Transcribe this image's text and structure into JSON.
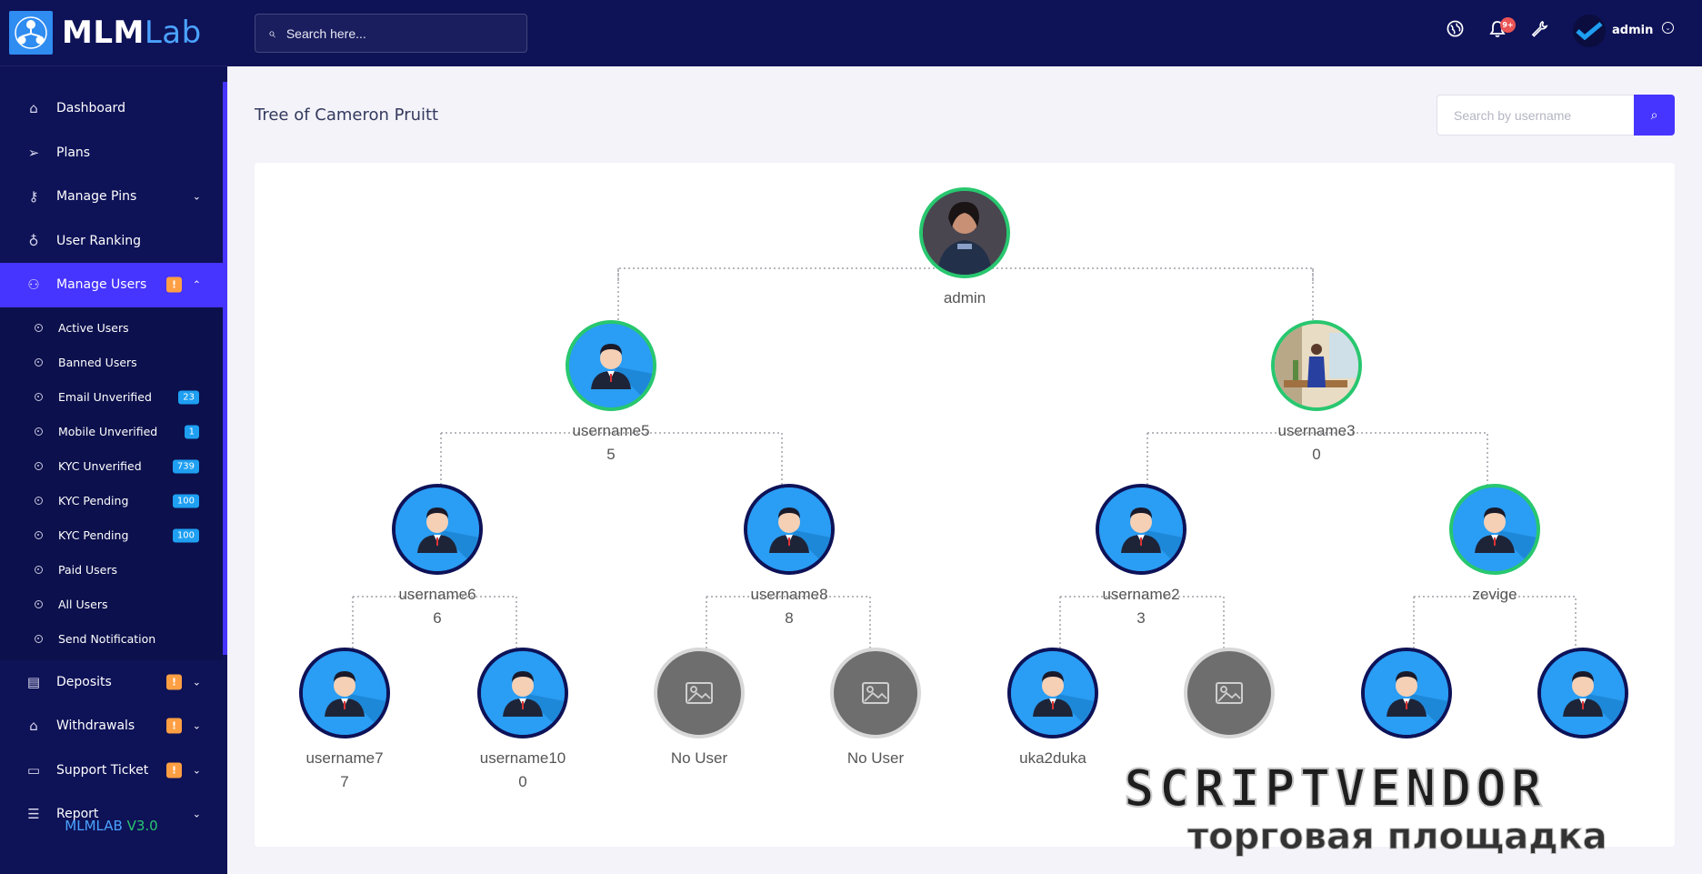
{
  "brand": {
    "logo_bold": "MLM",
    "logo_light": "Lab"
  },
  "sidebar": {
    "items": [
      {
        "label": "Dashboard",
        "icon": "home-icon"
      },
      {
        "label": "Plans",
        "icon": "send-icon"
      },
      {
        "label": "Manage Pins",
        "icon": "key-icon",
        "chevron": "down"
      },
      {
        "label": "User Ranking",
        "icon": "medal-icon"
      },
      {
        "label": "Manage Users",
        "icon": "users-icon",
        "badge": "!",
        "chevron": "up",
        "active": true
      }
    ],
    "subitems": [
      {
        "label": "Active Users"
      },
      {
        "label": "Banned Users"
      },
      {
        "label": "Email Unverified",
        "count": "23"
      },
      {
        "label": "Mobile Unverified",
        "count": "1"
      },
      {
        "label": "KYC Unverified",
        "count": "739"
      },
      {
        "label": "KYC Pending",
        "count": "100"
      },
      {
        "label": "KYC Pending",
        "count": "100"
      },
      {
        "label": "Paid Users"
      },
      {
        "label": "All Users"
      },
      {
        "label": "Send Notification"
      }
    ],
    "items_after": [
      {
        "label": "Deposits",
        "icon": "deposit-icon",
        "badge": "!"
      },
      {
        "label": "Withdrawals",
        "icon": "bank-icon",
        "badge": "!"
      },
      {
        "label": "Support Ticket",
        "icon": "ticket-icon",
        "badge": "!"
      },
      {
        "label": "Report",
        "icon": "list-icon"
      }
    ],
    "version_name": "MLMLAB",
    "version_num": "V3.0"
  },
  "topbar": {
    "search_placeholder": "Search here...",
    "notification_count": "9+",
    "user_name": "admin"
  },
  "main": {
    "title": "Tree of Cameron Pruitt",
    "search_placeholder": "Search by username"
  },
  "tree": {
    "root": {
      "name": "admin",
      "avatar": "photo-woman"
    },
    "level1": [
      {
        "name": "username5",
        "count": "5",
        "avatar": "default",
        "ring": "green"
      },
      {
        "name": "username3",
        "count": "0",
        "avatar": "photo-man",
        "ring": "green"
      }
    ],
    "level2": [
      {
        "name": "username6",
        "count": "6",
        "ring": "dark"
      },
      {
        "name": "username8",
        "count": "8",
        "ring": "dark"
      },
      {
        "name": "username2",
        "count": "3",
        "ring": "dark"
      },
      {
        "name": "zevige",
        "count": "",
        "ring": "green"
      }
    ],
    "level3": [
      {
        "name": "username7",
        "count": "7",
        "type": "user"
      },
      {
        "name": "username10",
        "count": "0",
        "type": "user"
      },
      {
        "name": "No User",
        "count": "",
        "type": "empty"
      },
      {
        "name": "No User",
        "count": "",
        "type": "empty"
      },
      {
        "name": "uka2duka",
        "count": "",
        "type": "user"
      },
      {
        "name": "",
        "count": "",
        "type": "empty"
      },
      {
        "name": "",
        "count": "",
        "type": "user"
      },
      {
        "name": "",
        "count": "",
        "type": "user"
      }
    ]
  },
  "watermark": {
    "line1": "SCRIPTVENDOR",
    "line2": "торговая площадка"
  },
  "colors": {
    "sidebar": "#0e1257",
    "accent": "#4634ff",
    "green_ring": "#28c76f",
    "dark_ring": "#0e1257",
    "warn": "#ff9f43",
    "info": "#1e9ff2"
  }
}
